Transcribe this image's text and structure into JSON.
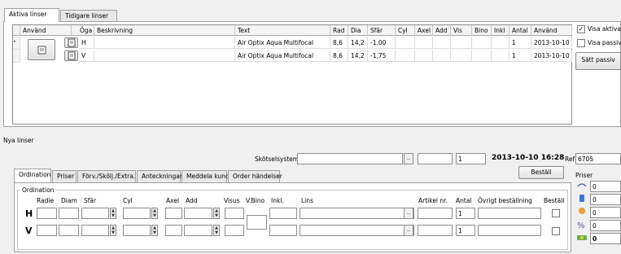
{
  "top_tabs": [
    "Aktiva linser",
    "Tidigare linser"
  ],
  "grid": {
    "headers": [
      "Använd",
      "Öga",
      "Beskrivning",
      "Text",
      "Rad",
      "Dia",
      "Sfär",
      "Cyl",
      "Axel",
      "Add",
      "Vis",
      "Bino",
      "Inkl",
      "Antal",
      "Använd"
    ],
    "rows": [
      {
        "eye": "H",
        "text": "Air Optix Aqua Multifocal",
        "rad": "8,6",
        "dia": "14,2",
        "sfar": "-1,00",
        "antal": "1",
        "date": "2013-10-10"
      },
      {
        "eye": "V",
        "text": "Air Optix Aqua Multifocal",
        "rad": "8,6",
        "dia": "14,2",
        "sfar": "-1,75",
        "antal": "1",
        "date": "2013-10-10"
      }
    ]
  },
  "right": {
    "show_active": "Visa aktiva",
    "show_passive": "Visa passiva",
    "set_passive": "Sätt passiv"
  },
  "new_lenses": "Nya linser",
  "care_label": "Skötselsystem",
  "care_qty": "1",
  "datetime": "2013-10-10 16:28",
  "ref_label": "Ref",
  "ref_value": "6705",
  "order_button": "Beställ",
  "priser_label": "Priser",
  "prices": [
    "0",
    "0",
    "0",
    "0",
    "0"
  ],
  "sub_tabs": [
    "Ordination",
    "Priser",
    "Förv./Skölj./Extra.",
    "Anteckningar",
    "Meddela kund",
    "Order händelser"
  ],
  "ordination": {
    "group": "Ordination",
    "columns": [
      "Radie",
      "Diam",
      "Sfär",
      "Cyl",
      "Axel",
      "Add",
      "Visus",
      "V.Bino",
      "Inkl.",
      "Lins",
      "Artikel nr.",
      "Antal",
      "Övrigt beställning",
      "Beställ"
    ],
    "eyes": [
      {
        "label": "H",
        "antal": "1"
      },
      {
        "label": "V",
        "antal": "1"
      }
    ]
  }
}
